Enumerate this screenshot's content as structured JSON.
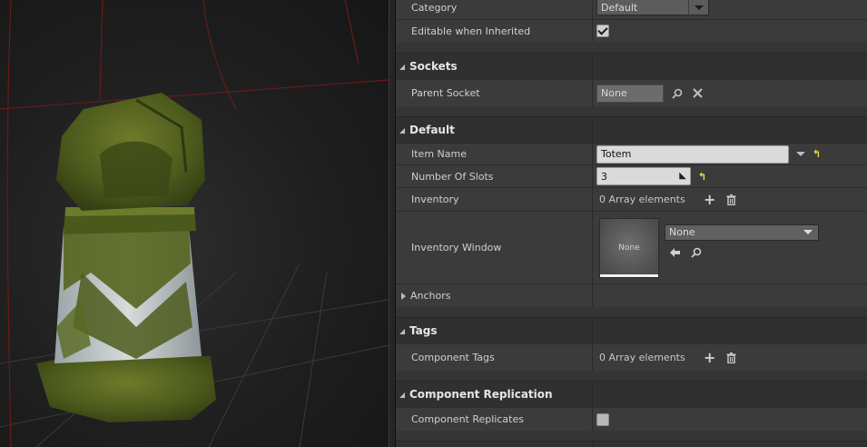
{
  "details": {
    "rows": {
      "category": {
        "label": "Category",
        "value": "Default"
      },
      "editable": {
        "label": "Editable when Inherited",
        "checked": true
      },
      "sockets": {
        "title": "Sockets"
      },
      "parent_socket": {
        "label": "Parent Socket",
        "value": "None"
      },
      "default": {
        "title": "Default"
      },
      "item_name": {
        "label": "Item Name",
        "value": "Totem"
      },
      "num_slots": {
        "label": "Number Of Slots",
        "value": "3"
      },
      "inventory": {
        "label": "Inventory",
        "value": "0 Array elements"
      },
      "inventory_window": {
        "label": "Inventory Window",
        "thumb_text": "None",
        "value": "None"
      },
      "anchors": {
        "label": "Anchors"
      },
      "tags": {
        "title": "Tags"
      },
      "component_tags": {
        "label": "Component Tags",
        "value": "0 Array elements"
      },
      "replication": {
        "title": "Component Replication"
      },
      "replicates": {
        "label": "Component Replicates",
        "checked": false
      }
    }
  },
  "icons": {
    "search": "search-icon",
    "clear": "clear-icon",
    "add": "add-icon",
    "delete": "trash-icon",
    "reset": "reset-to-default-icon",
    "use_selected": "use-selected-icon"
  },
  "colors": {
    "reset_arrow": "#e8e04a",
    "panel_bg": "#353535"
  }
}
